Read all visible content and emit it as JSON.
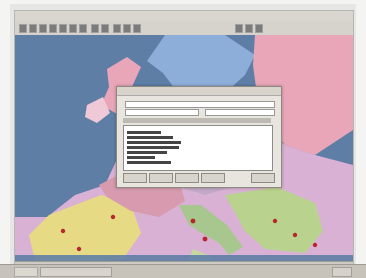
{
  "window": {
    "title": ""
  },
  "toolbar": {
    "text": ""
  },
  "dialog": {
    "title": ""
  },
  "status": {
    "text": ""
  },
  "colors": {
    "sea": "#5e7ea6",
    "land_pink": "#e9a6b9",
    "land_green": "#a8c78f",
    "land_yellow": "#e7da84",
    "land_blue": "#7f9fcf",
    "marker": "#b8262b"
  },
  "icons": [
    "toolbar-button-icons",
    "map-marker-icons",
    "start-button-icon"
  ]
}
